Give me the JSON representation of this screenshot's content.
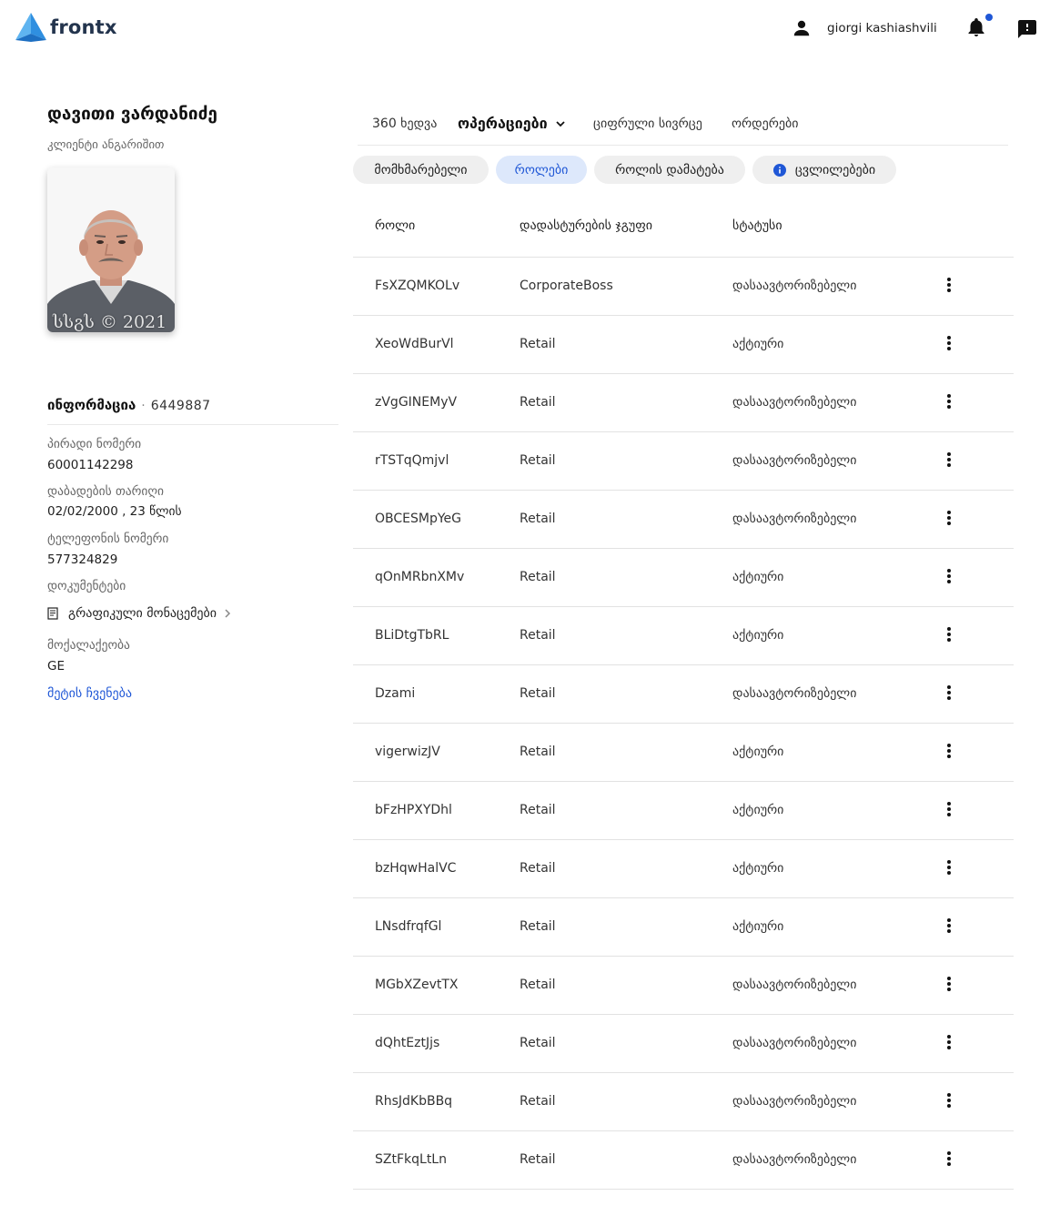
{
  "app": {
    "name": "frontx"
  },
  "header": {
    "user_name": "giorgi kashiashvili"
  },
  "client": {
    "name": "დავითი ვარდანიძე",
    "subtitle": "კლიენტი ანგარიშით",
    "photo_watermark": "სსგს © 2021",
    "info_title": "ინფორმაცია",
    "info_id": "6449887",
    "fields": {
      "personal_no_label": "პირადი ნომერი",
      "personal_no_value": "60001142298",
      "birth_label": "დაბადების თარიღი",
      "birth_value": "02/02/2000 , 23 წლის",
      "phone_label": "ტელეფონის ნომერი",
      "phone_value": "577324829",
      "docs_label": "დოკუმენტები",
      "docs_link": "გრაფიკული მონაცემები",
      "citizenship_label": "მოქალაქეობა",
      "citizenship_value": "GE"
    },
    "more_link": "მეტის ჩვენება"
  },
  "tabs": {
    "t1": "360 ხედვა",
    "t2": "ოპერაციები",
    "t3": "ციფრული სივრცე",
    "t4": "ორდერები"
  },
  "chips": {
    "c1": "მომხმარებელი",
    "c2": "როლები",
    "c3": "როლის დამატება",
    "c4": "ცვლილებები"
  },
  "table": {
    "headers": {
      "role": "როლი",
      "group": "დადასტურების ჯგუფი",
      "status": "სტატუსი"
    },
    "rows": [
      {
        "role": "FsXZQMKOLv",
        "group": "CorporateBoss",
        "status": "დასაავტორიზებელი"
      },
      {
        "role": "XeoWdBurVl",
        "group": "Retail",
        "status": "აქტიური"
      },
      {
        "role": "zVgGINEMyV",
        "group": "Retail",
        "status": "დასაავტორიზებელი"
      },
      {
        "role": "rTSTqQmjvl",
        "group": "Retail",
        "status": "დასაავტორიზებელი"
      },
      {
        "role": "OBCESMpYeG",
        "group": "Retail",
        "status": "დასაავტორიზებელი"
      },
      {
        "role": "qOnMRbnXMv",
        "group": "Retail",
        "status": "აქტიური"
      },
      {
        "role": "BLiDtgTbRL",
        "group": "Retail",
        "status": "აქტიური"
      },
      {
        "role": "Dzami",
        "group": "Retail",
        "status": "დასაავტორიზებელი"
      },
      {
        "role": "vigerwizJV",
        "group": "Retail",
        "status": "აქტიური"
      },
      {
        "role": "bFzHPXYDhl",
        "group": "Retail",
        "status": "აქტიური"
      },
      {
        "role": "bzHqwHalVC",
        "group": "Retail",
        "status": "აქტიური"
      },
      {
        "role": "LNsdfrqfGl",
        "group": "Retail",
        "status": "აქტიური"
      },
      {
        "role": "MGbXZevtTX",
        "group": "Retail",
        "status": "დასაავტორიზებელი"
      },
      {
        "role": "dQhtEztJjs",
        "group": "Retail",
        "status": "დასაავტორიზებელი"
      },
      {
        "role": "RhsJdKbBBq",
        "group": "Retail",
        "status": "დასაავტორიზებელი"
      },
      {
        "role": "SZtFkqLtLn",
        "group": "Retail",
        "status": "დასაავტორიზებელი"
      }
    ]
  }
}
